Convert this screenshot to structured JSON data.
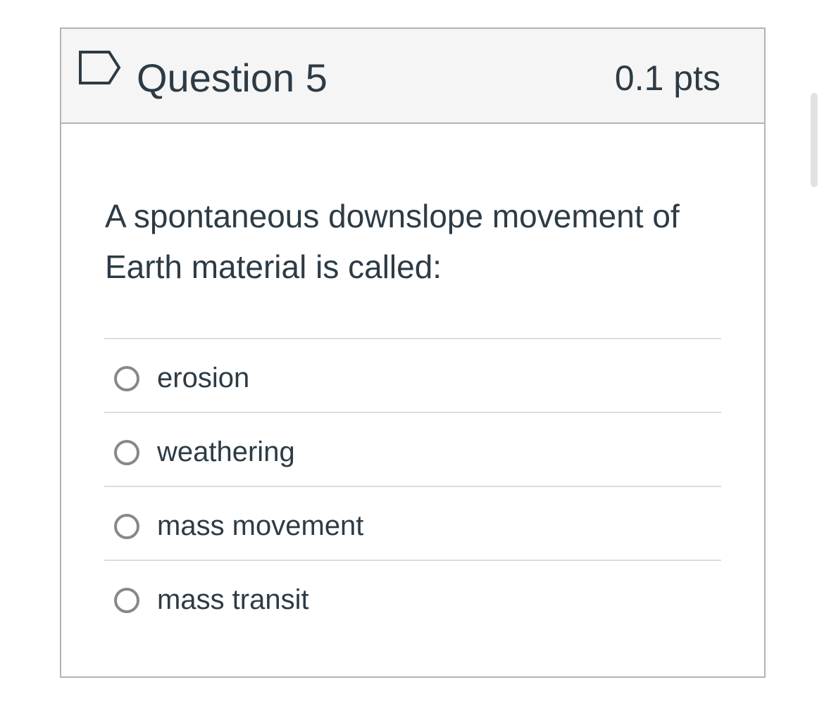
{
  "question": {
    "title": "Question 5",
    "points": "0.1 pts",
    "text": "A spontaneous downslope movement of Earth material is called:",
    "flag_icon": "flag-icon"
  },
  "answers": [
    {
      "label": "erosion",
      "selected": false
    },
    {
      "label": "weathering",
      "selected": false
    },
    {
      "label": "mass movement",
      "selected": false
    },
    {
      "label": "mass transit",
      "selected": false
    }
  ],
  "colors": {
    "header_background": "#f5f5f5",
    "border": "#b3b3b3",
    "text": "#2d3b45",
    "divider": "#dadcde",
    "radio_border": "#888888"
  }
}
